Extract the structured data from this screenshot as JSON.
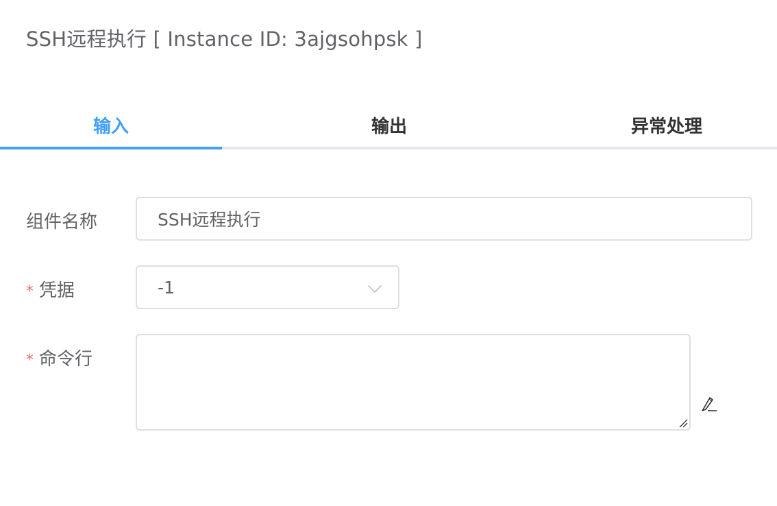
{
  "header": {
    "title": "SSH远程执行 [ Instance ID: 3ajgsohpsk ]"
  },
  "tabs": [
    {
      "label": "输入",
      "active": true
    },
    {
      "label": "输出",
      "active": false
    },
    {
      "label": "异常处理",
      "active": false
    }
  ],
  "form": {
    "name_label": "组件名称",
    "name_value": "SSH远程执行",
    "credential_label": "凭据",
    "credential_value": "-1",
    "command_label": "命令行",
    "command_value": "",
    "required_mark": "*"
  },
  "colors": {
    "accent": "#409eff",
    "required": "#f56c6c"
  },
  "icons": {
    "select": "chevron-down-icon",
    "edit": "pencil-icon"
  }
}
